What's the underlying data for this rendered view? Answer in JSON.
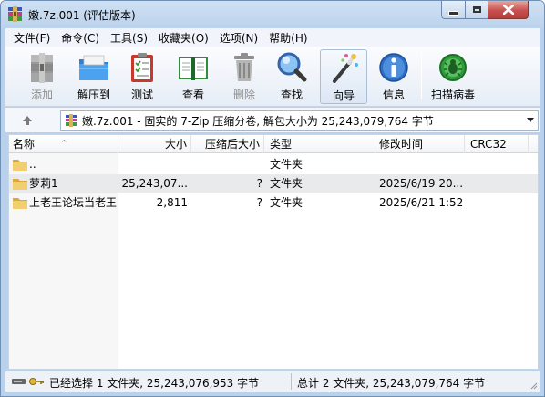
{
  "window": {
    "title": "嫩.7z.001 (评估版本)"
  },
  "menu": [
    "文件(F)",
    "命令(C)",
    "工具(S)",
    "收藏夹(O)",
    "选项(N)",
    "帮助(H)"
  ],
  "toolbar": {
    "add": "添加",
    "extract": "解压到",
    "test": "测试",
    "view": "查看",
    "delete": "删除",
    "find": "查找",
    "wizard": "向导",
    "info": "信息",
    "virus": "扫描病毒"
  },
  "address": {
    "path": "嫩.7z.001 - 固实的 7-Zip 压缩分卷, 解包大小为 25,243,079,764 字节"
  },
  "columns": {
    "name": "名称",
    "size": "大小",
    "packed": "压缩后大小",
    "type": "类型",
    "modified": "修改时间",
    "crc": "CRC32"
  },
  "rows": [
    {
      "name": "..",
      "size": "",
      "packed": "",
      "type": "文件夹",
      "modified": ""
    },
    {
      "name": "萝莉1",
      "size": "25,243,07...",
      "packed": "?",
      "type": "文件夹",
      "modified": "2025/6/19 20..."
    },
    {
      "name": "上老王论坛当老王",
      "size": "2,811",
      "packed": "?",
      "type": "文件夹",
      "modified": "2025/6/21 1:52"
    }
  ],
  "status": {
    "left": "已经选择 1 文件夹, 25,243,076,953 字节",
    "right": "总计 2 文件夹, 25,243,079,764 字节"
  },
  "colors": {
    "titlebar": "#bcd3ec",
    "close_button": "#c75050",
    "selected_row": "#e9eaec",
    "folder": "#e8c15a"
  }
}
